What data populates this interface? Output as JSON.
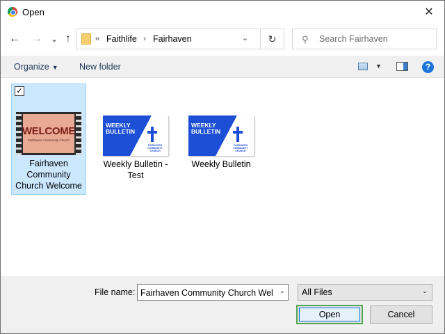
{
  "window": {
    "title": "Open",
    "close_glyph": "✕"
  },
  "nav": {
    "back_glyph": "←",
    "forward_glyph": "→",
    "recent_glyph": "⌄",
    "up_glyph": "↑"
  },
  "address": {
    "overflow_glyph": "«",
    "breadcrumbs": [
      "Faithlife",
      "Fairhaven"
    ],
    "separator": "›",
    "dropdown_glyph": "⌄",
    "refresh_glyph": "↻"
  },
  "search": {
    "placeholder": "Search Fairhaven",
    "icon_glyph": "⚲"
  },
  "commandbar": {
    "organize_label": "Organize",
    "organize_caret": "▼",
    "new_folder_label": "New folder",
    "view_caret": "▼",
    "help_glyph": "?"
  },
  "files": [
    {
      "name": "Fairhaven Community Church Welcome",
      "selected": true,
      "checked_glyph": "✓",
      "thumb_title": "WELCOME",
      "thumb_subtitle": "Fairhaven Community Church"
    },
    {
      "name": "Weekly Bulletin - Test",
      "selected": false,
      "thumb_title_line1": "WEEKLY",
      "thumb_title_line2": "BULLETIN",
      "thumb_org": "FAIRHAVEN COMMUNITY CHURCH"
    },
    {
      "name": "Weekly Bulletin",
      "selected": false,
      "thumb_title_line1": "WEEKLY",
      "thumb_title_line2": "BULLETIN",
      "thumb_org": "FAIRHAVEN COMMUNITY CHURCH"
    }
  ],
  "bottom": {
    "file_name_label": "File name:",
    "file_name_value": "Fairhaven Community Church Welc",
    "file_name_dropdown_glyph": "⌄",
    "filter_value": "All Files",
    "filter_dropdown_glyph": "⌄",
    "open_label": "Open",
    "cancel_label": "Cancel"
  },
  "colors": {
    "selection_bg": "#cce8ff",
    "selection_border": "#99d1ff",
    "focus_green": "#53a653",
    "link_blue": "#1e395b",
    "bulletin_blue": "#1d4fd6"
  }
}
